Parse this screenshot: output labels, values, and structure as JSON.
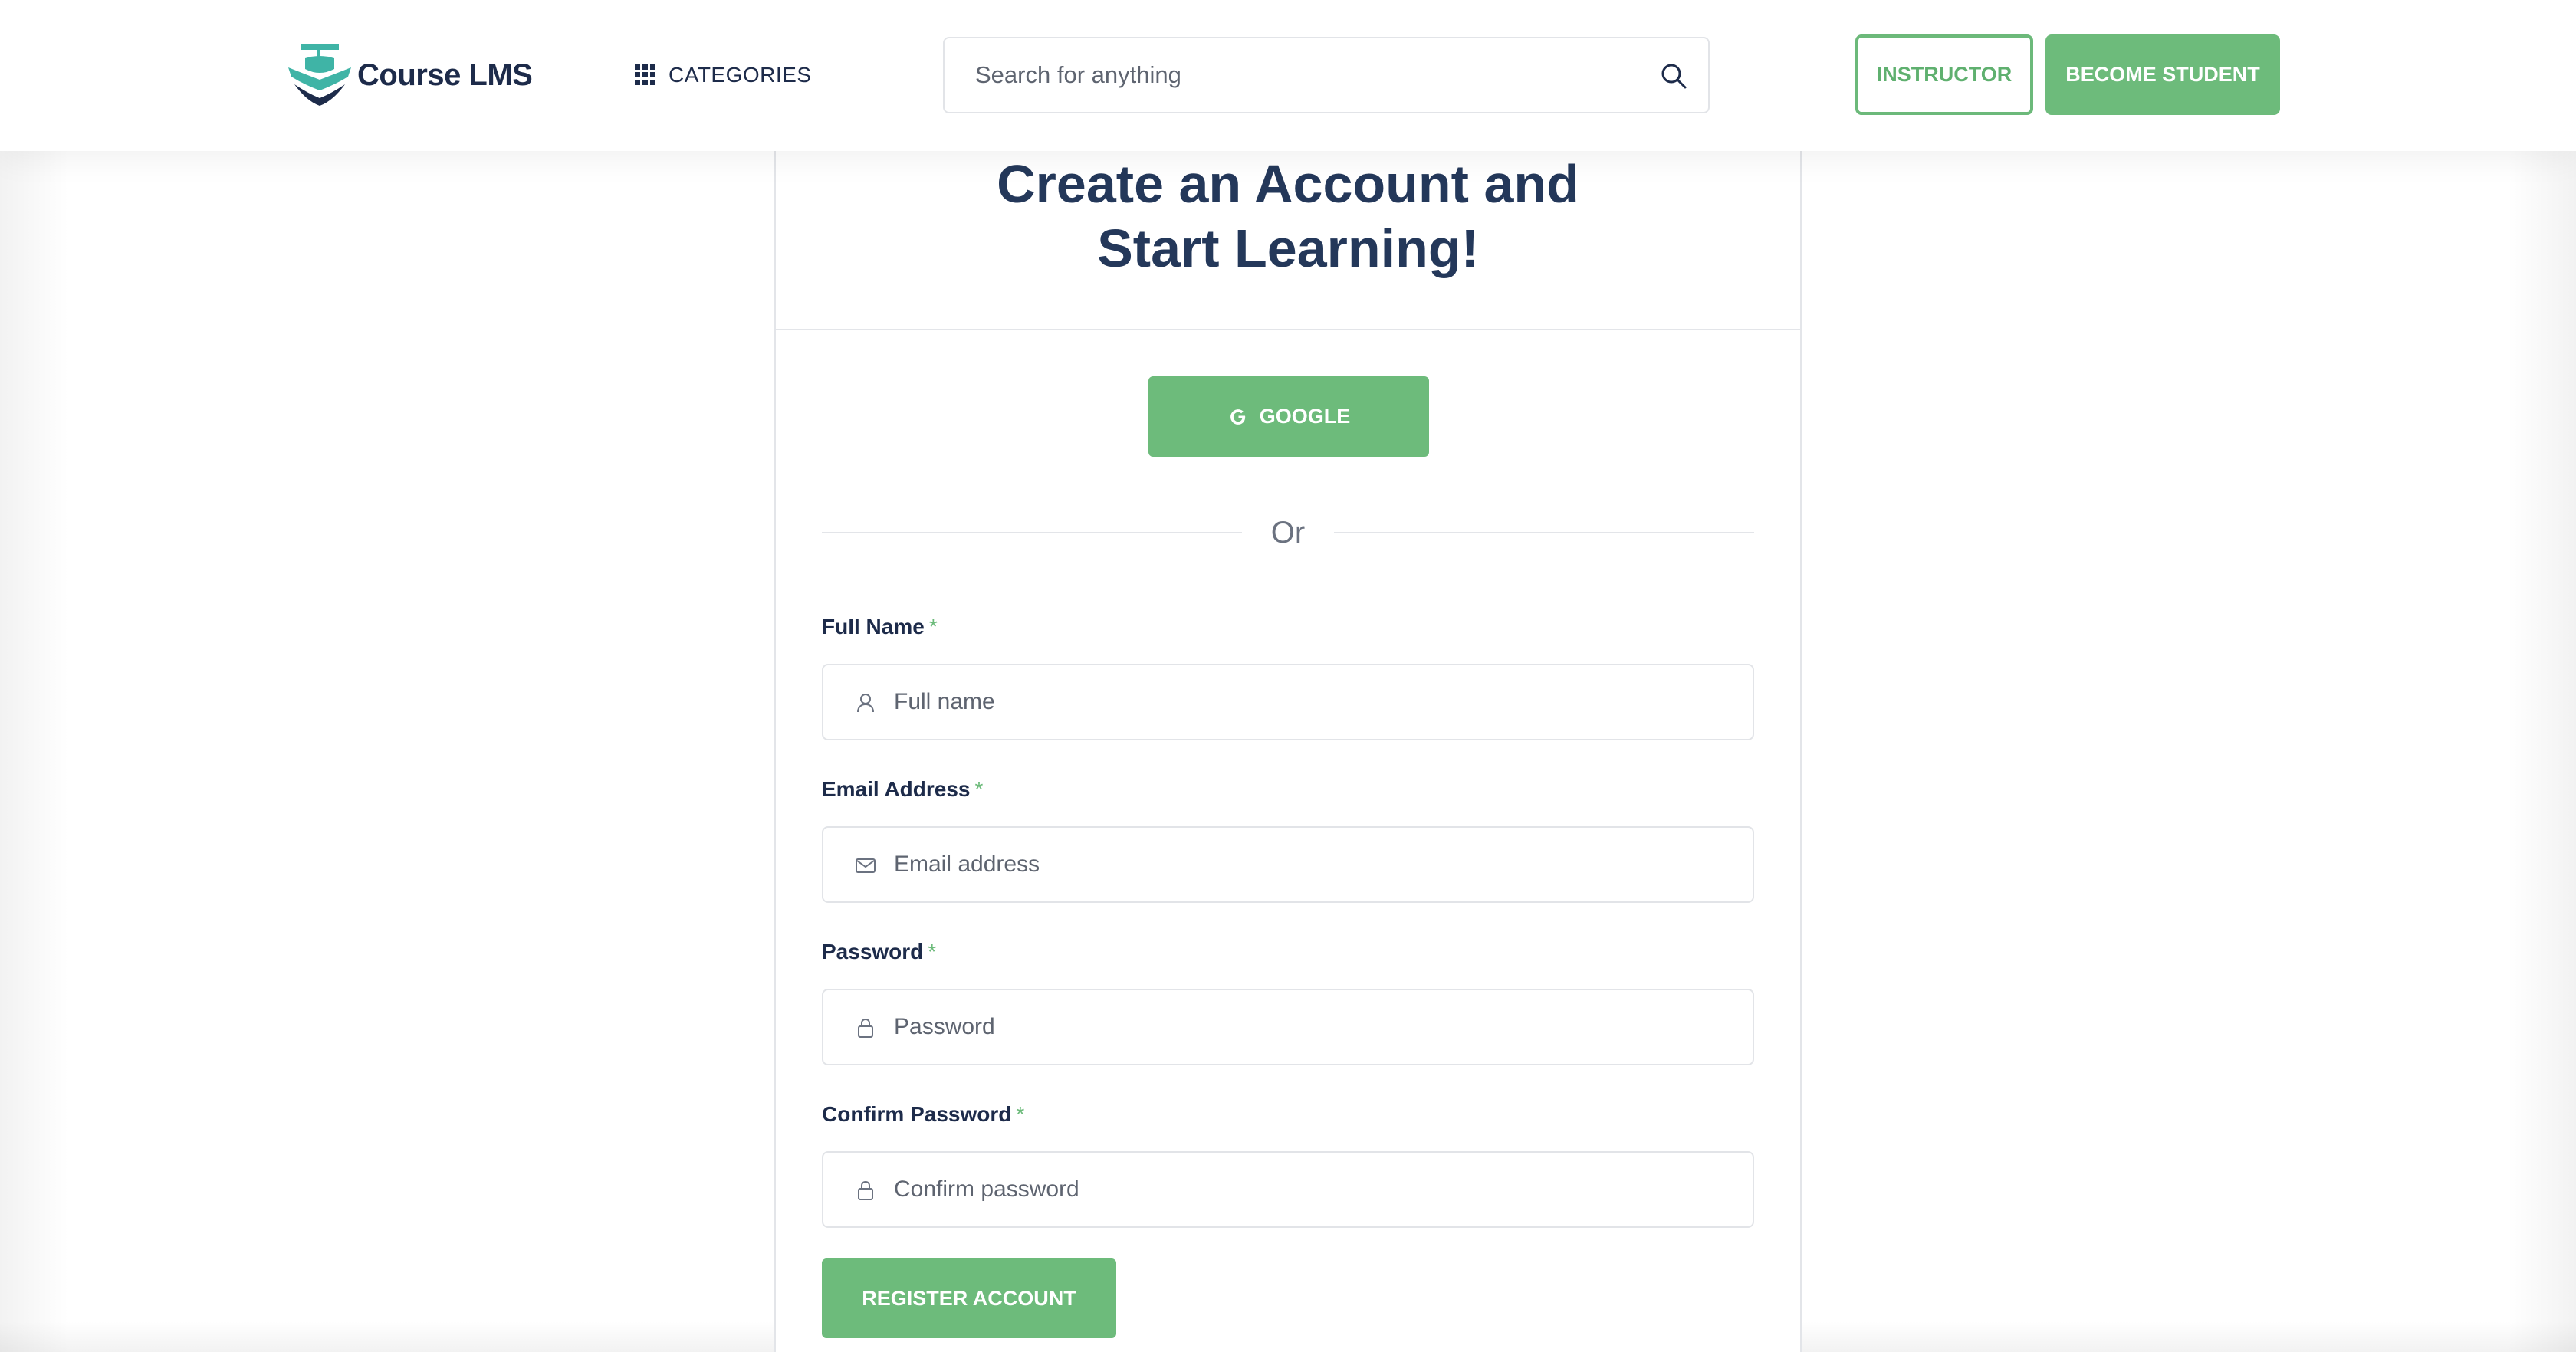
{
  "header": {
    "logo_text": "Course LMS",
    "categories_label": "CATEGORIES",
    "search_placeholder": "Search for anything",
    "instructor_label": "INSTRUCTOR",
    "become_student_label": "BECOME STUDENT"
  },
  "form": {
    "title_line1": "Create an Account and",
    "title_line2": "Start Learning!",
    "google_label": "GOOGLE",
    "or_label": "Or",
    "required_marker": "*",
    "fields": [
      {
        "label": "Full Name",
        "placeholder": "Full name",
        "icon": "user-icon"
      },
      {
        "label": "Email Address",
        "placeholder": "Email address",
        "icon": "mail-icon"
      },
      {
        "label": "Password",
        "placeholder": "Password",
        "icon": "lock-icon"
      },
      {
        "label": "Confirm Password",
        "placeholder": "Confirm password",
        "icon": "lock-icon"
      }
    ],
    "submit_label": "REGISTER ACCOUNT"
  },
  "colors": {
    "accent_green": "#6dbb7b",
    "heading_navy": "#24385a",
    "text_navy": "#1d2b4a",
    "logo_teal": "#3fb4a6"
  }
}
